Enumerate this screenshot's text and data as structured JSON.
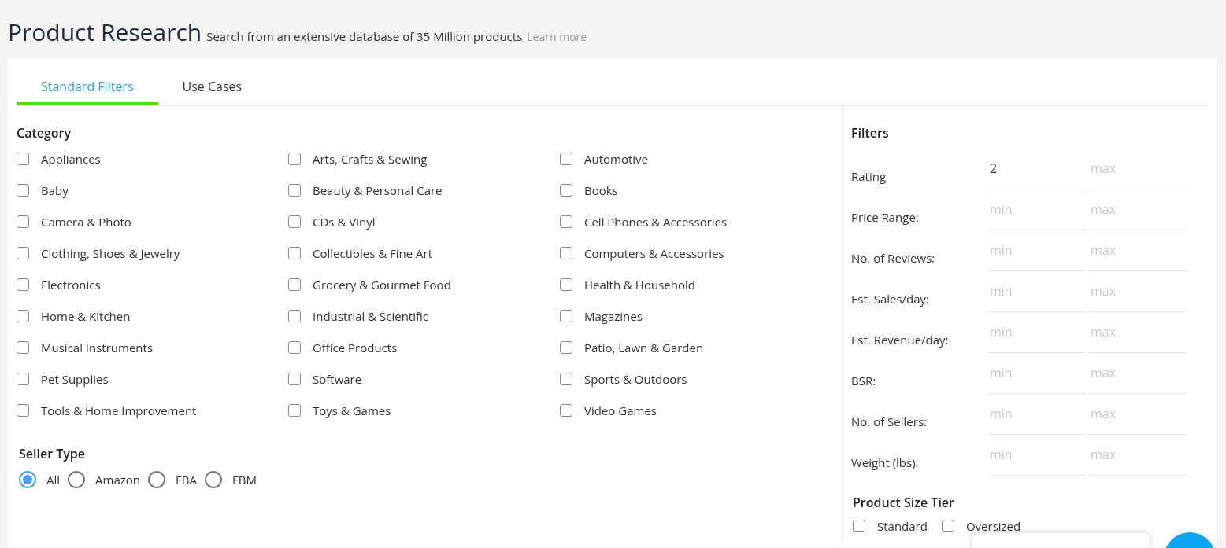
{
  "header": {
    "title": "Product Research",
    "subtitle": "Search from an extensive database of 35 Million products",
    "link": "Learn more"
  },
  "tabs": [
    {
      "label": "Standard Filters",
      "selected": true
    },
    {
      "label": "Use Cases",
      "selected": false
    }
  ],
  "category": {
    "title": "Category",
    "items": [
      {
        "label": "Appliances",
        "checked": false
      },
      {
        "label": "Arts, Crafts & Sewing",
        "checked": false
      },
      {
        "label": "Automotive",
        "checked": false
      },
      {
        "label": "Baby",
        "checked": false
      },
      {
        "label": "Beauty & Personal Care",
        "checked": false
      },
      {
        "label": "Books",
        "checked": false
      },
      {
        "label": "Camera & Photo",
        "checked": false
      },
      {
        "label": "CDs & Vinyl",
        "checked": false
      },
      {
        "label": "Cell Phones & Accessories",
        "checked": false
      },
      {
        "label": "Clothing, Shoes & Jewelry",
        "checked": false
      },
      {
        "label": "Collectibles & Fine Art",
        "checked": false
      },
      {
        "label": "Computers & Accessories",
        "checked": false
      },
      {
        "label": "Electronics",
        "checked": false
      },
      {
        "label": "Grocery & Gourmet Food",
        "checked": false
      },
      {
        "label": "Health & Household",
        "checked": false
      },
      {
        "label": "Home & Kitchen",
        "checked": false
      },
      {
        "label": "Industrial & Scientific",
        "checked": false
      },
      {
        "label": "Magazines",
        "checked": false
      },
      {
        "label": "Musical Instruments",
        "checked": false
      },
      {
        "label": "Office Products",
        "checked": false
      },
      {
        "label": "Patio, Lawn & Garden",
        "checked": false
      },
      {
        "label": "Pet Supplies",
        "checked": false
      },
      {
        "label": "Software",
        "checked": false
      },
      {
        "label": "Sports & Outdoors",
        "checked": false
      },
      {
        "label": "Tools & Home Improvement",
        "checked": false
      },
      {
        "label": "Toys & Games",
        "checked": false
      },
      {
        "label": "Video Games",
        "checked": false
      }
    ]
  },
  "seller_type": {
    "title": "Seller Type",
    "options": [
      {
        "label": "All",
        "selected": true
      },
      {
        "label": "Amazon",
        "selected": false
      },
      {
        "label": "FBA",
        "selected": false
      },
      {
        "label": "FBM",
        "selected": false
      }
    ]
  },
  "filters": {
    "title": "Filters",
    "rows": [
      {
        "label": "Rating",
        "min": {
          "value": "2"
        },
        "max": {
          "placeholder": "max"
        }
      },
      {
        "label": "Price Range:",
        "min": {
          "placeholder": "min"
        },
        "max": {
          "placeholder": "max"
        }
      },
      {
        "label": "No. of Reviews:",
        "min": {
          "placeholder": "min"
        },
        "max": {
          "placeholder": "max"
        }
      },
      {
        "label": "Est. Sales/day:",
        "min": {
          "placeholder": "min"
        },
        "max": {
          "placeholder": "max"
        }
      },
      {
        "label": "Est. Revenue/day:",
        "min": {
          "placeholder": "min"
        },
        "max": {
          "placeholder": "max"
        }
      },
      {
        "label": "BSR:",
        "min": {
          "placeholder": "min"
        },
        "max": {
          "placeholder": "max"
        }
      },
      {
        "label": "No. of Sellers:",
        "min": {
          "placeholder": "min"
        },
        "max": {
          "placeholder": "max"
        }
      },
      {
        "label": "Weight (lbs):",
        "min": {
          "placeholder": "min"
        },
        "max": {
          "placeholder": "max"
        }
      }
    ]
  },
  "size_tier": {
    "title": "Product Size Tier",
    "items": [
      {
        "label": "Standard",
        "checked": false
      },
      {
        "label": "Oversized",
        "checked": false
      }
    ]
  }
}
